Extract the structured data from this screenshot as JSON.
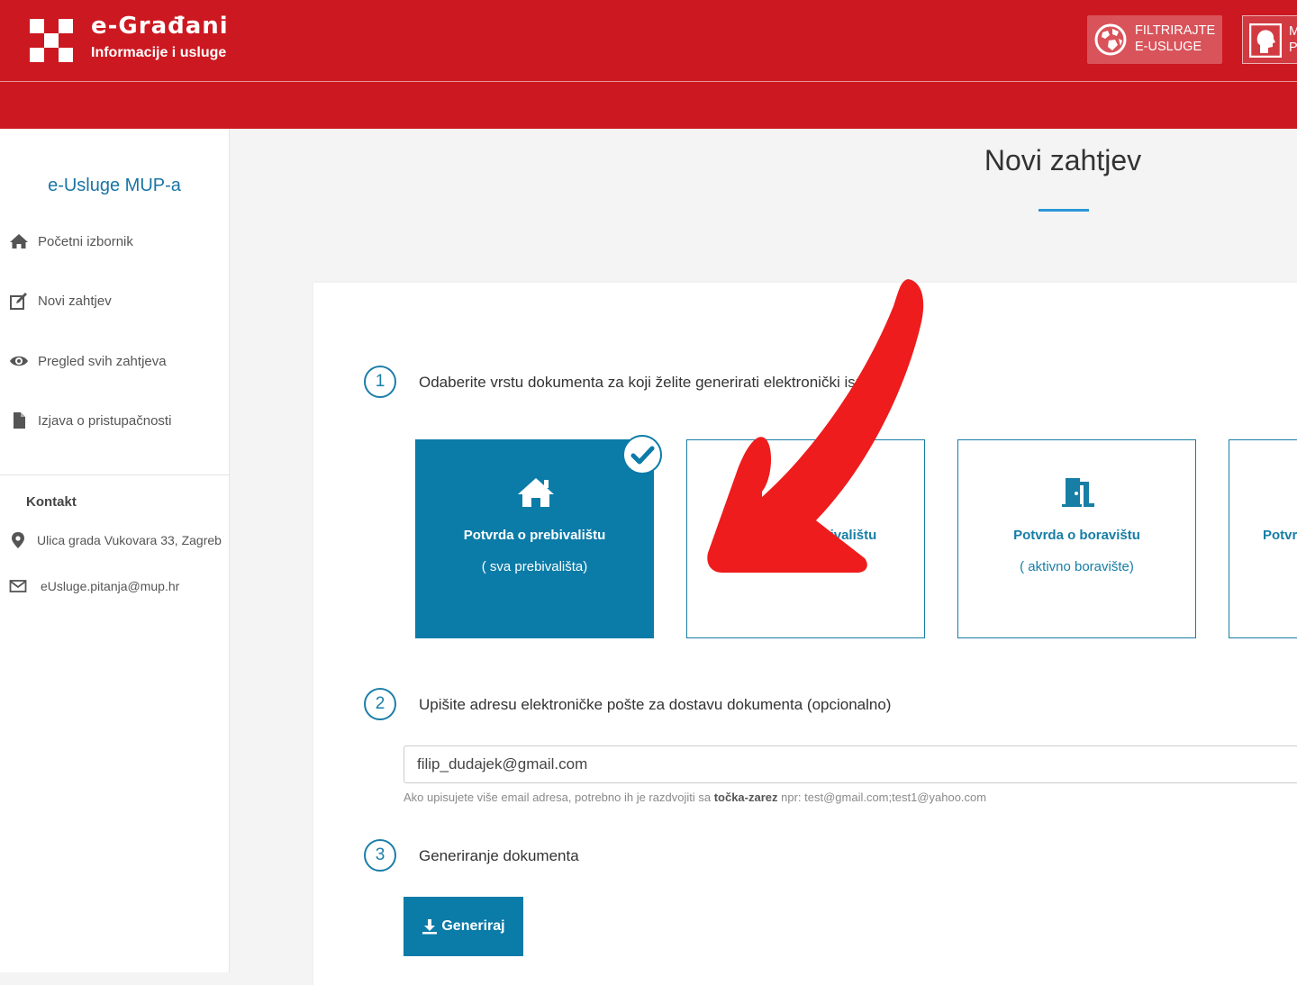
{
  "header": {
    "brand_title": "e-Građani",
    "brand_subtitle": "Informacije i usluge",
    "filter_button": {
      "line1": "FILTRIRAJTE",
      "line2": "E-USLUGE",
      "icon": "globe-icon"
    },
    "profile_button": {
      "line1": "M",
      "line2": "P",
      "icon": "user-profile-icon"
    }
  },
  "sidebar": {
    "title": "e-Usluge MUP-a",
    "items": [
      {
        "label": "Početni izbornik",
        "icon": "home-icon"
      },
      {
        "label": "Novi zahtjev",
        "icon": "edit-icon"
      },
      {
        "label": "Pregled svih zahtjeva",
        "icon": "eye-icon"
      },
      {
        "label": "Izjava o pristupačnosti",
        "icon": "document-icon"
      }
    ],
    "contact": {
      "heading": "Kontakt",
      "address": "Ulica grada Vukovara 33, Zagreb",
      "email": "eUsluge.pitanja@mup.hr"
    }
  },
  "main": {
    "page_title": "Novi zahtjev",
    "step1": {
      "number": "1",
      "text": "Odaberite vrstu dokumenta za koji želite generirati elektronički ispis"
    },
    "tiles": [
      {
        "title": "Potvrda o prebivalištu",
        "subtitle": "( sva prebivališta)",
        "selected": true,
        "icon": "house-icon"
      },
      {
        "title": "Potvrda o prebivalištu",
        "subtitle": "",
        "selected": false,
        "icon": "house-icon"
      },
      {
        "title": "Potvrda o boravištu",
        "subtitle": "( aktivno boravište)",
        "selected": false,
        "icon": "door-icon"
      },
      {
        "title": "Potvrda",
        "subtitle": "",
        "selected": false,
        "icon": ""
      }
    ],
    "step2": {
      "number": "2",
      "text": "Upišite adresu elektroničke pošte za dostavu dokumenta (opcionalno)"
    },
    "email_value": "filip_dudajek@gmail.com",
    "hint": {
      "before": "Ako upisujete više email adresa, potrebno ih je razdvojiti sa ",
      "bold": "točka-zarez",
      "after": " npr: test@gmail.com;test1@yahoo.com"
    },
    "step3": {
      "number": "3",
      "text": "Generiranje dokumenta"
    },
    "generate_button": "Generiraj"
  },
  "colors": {
    "header_red": "#cc1820",
    "primary_blue": "#0b7ba8",
    "annotation_arrow": "#ee1c1c"
  }
}
